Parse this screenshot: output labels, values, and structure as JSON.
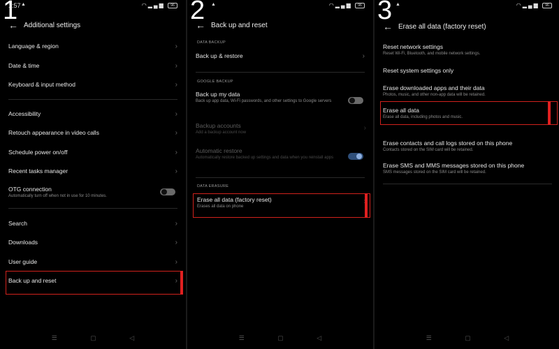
{
  "steps": [
    "1",
    "2",
    "3"
  ],
  "status": {
    "time1": "1:57",
    "battery": "96"
  },
  "icons": {
    "back": "←",
    "chevron": "›",
    "nav_menu": "☰",
    "nav_home": "▢",
    "nav_back": "◁",
    "alert": "▲",
    "wifi": "wifi-icon",
    "signal": "signal-icon"
  },
  "colors": {
    "highlight": "#d0211c",
    "toggle_on": "#2f4f7a"
  },
  "panel1": {
    "title": "Additional settings",
    "rows": [
      "Language & region",
      "Date & time",
      "Keyboard & input method",
      "Accessibility",
      "Retouch appearance in video calls",
      "Schedule power on/off",
      "Recent tasks manager"
    ],
    "otg": {
      "label": "OTG connection",
      "sub": "Automatically turn off when not in use for 10 minutes."
    },
    "rows2": [
      "Search",
      "Downloads",
      "User guide",
      "Back up and reset"
    ]
  },
  "panel2": {
    "title": "Back up and reset",
    "section_backup": "DATA BACKUP",
    "backup_restore": "Back up & restore",
    "section_google": "GOOGLE BACKUP",
    "backup_my_data": {
      "label": "Back up my data",
      "sub": "Back up app data, Wi-Fi passwords, and other settings to Google servers"
    },
    "backup_accounts": {
      "label": "Backup accounts",
      "sub": "Add a backup account now"
    },
    "auto_restore": {
      "label": "Automatic restore",
      "sub": "Automatically restore backed up settings and data when you reinstall apps"
    },
    "section_erasure": "DATA ERASURE",
    "erase_all": {
      "label": "Erase all data (factory reset)",
      "sub": "Erases all data on phone"
    }
  },
  "panel3": {
    "title": "Erase all data (factory reset)",
    "items": [
      {
        "label": "Reset network settings",
        "sub": "Reset Wi-Fi, Bluetooth, and mobile network settings."
      },
      {
        "label": "Reset system settings only",
        "sub": ""
      },
      {
        "label": "Erase downloaded apps and their data",
        "sub": "Photos, music, and other non-app data will be retained."
      },
      {
        "label": "Erase all data",
        "sub": "Erase all data, including photos and music."
      },
      {
        "label": "Erase contacts and call logs stored on this phone",
        "sub": "Contacts stored on the SIM card will be retained."
      },
      {
        "label": "Erase SMS and MMS messages stored on this phone",
        "sub": "SMS messages stored on the SIM card will be retained."
      }
    ]
  }
}
